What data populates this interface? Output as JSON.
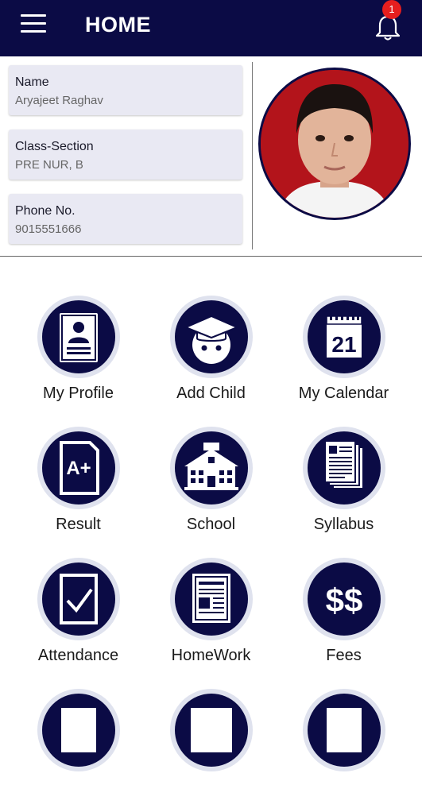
{
  "appbar": {
    "title": "HOME",
    "notification_count": "1"
  },
  "profile": {
    "fields": [
      {
        "label": "Name",
        "value": "Aryajeet Raghav"
      },
      {
        "label": "Class-Section",
        "value": "PRE NUR, B"
      },
      {
        "label": "Phone No.",
        "value": "9015551666"
      }
    ]
  },
  "menu": {
    "tiles": [
      {
        "label": "My Profile",
        "icon": "id-card-icon"
      },
      {
        "label": "Add Child",
        "icon": "graduate-icon"
      },
      {
        "label": "My Calendar",
        "icon": "calendar-icon",
        "calendar_day": "21"
      },
      {
        "label": "Result",
        "icon": "grade-icon",
        "grade": "A+"
      },
      {
        "label": "School",
        "icon": "school-building-icon"
      },
      {
        "label": "Syllabus",
        "icon": "documents-icon"
      },
      {
        "label": "Attendance",
        "icon": "checkbox-icon"
      },
      {
        "label": "HomeWork",
        "icon": "notebook-icon"
      },
      {
        "label": "Fees",
        "icon": "dollar-icon",
        "symbol": "$$"
      }
    ]
  },
  "colors": {
    "primary": "#0b0b45",
    "badge": "#e61e1e",
    "card": "#e9e9f3",
    "tile_ring": "#dfe2ee"
  }
}
